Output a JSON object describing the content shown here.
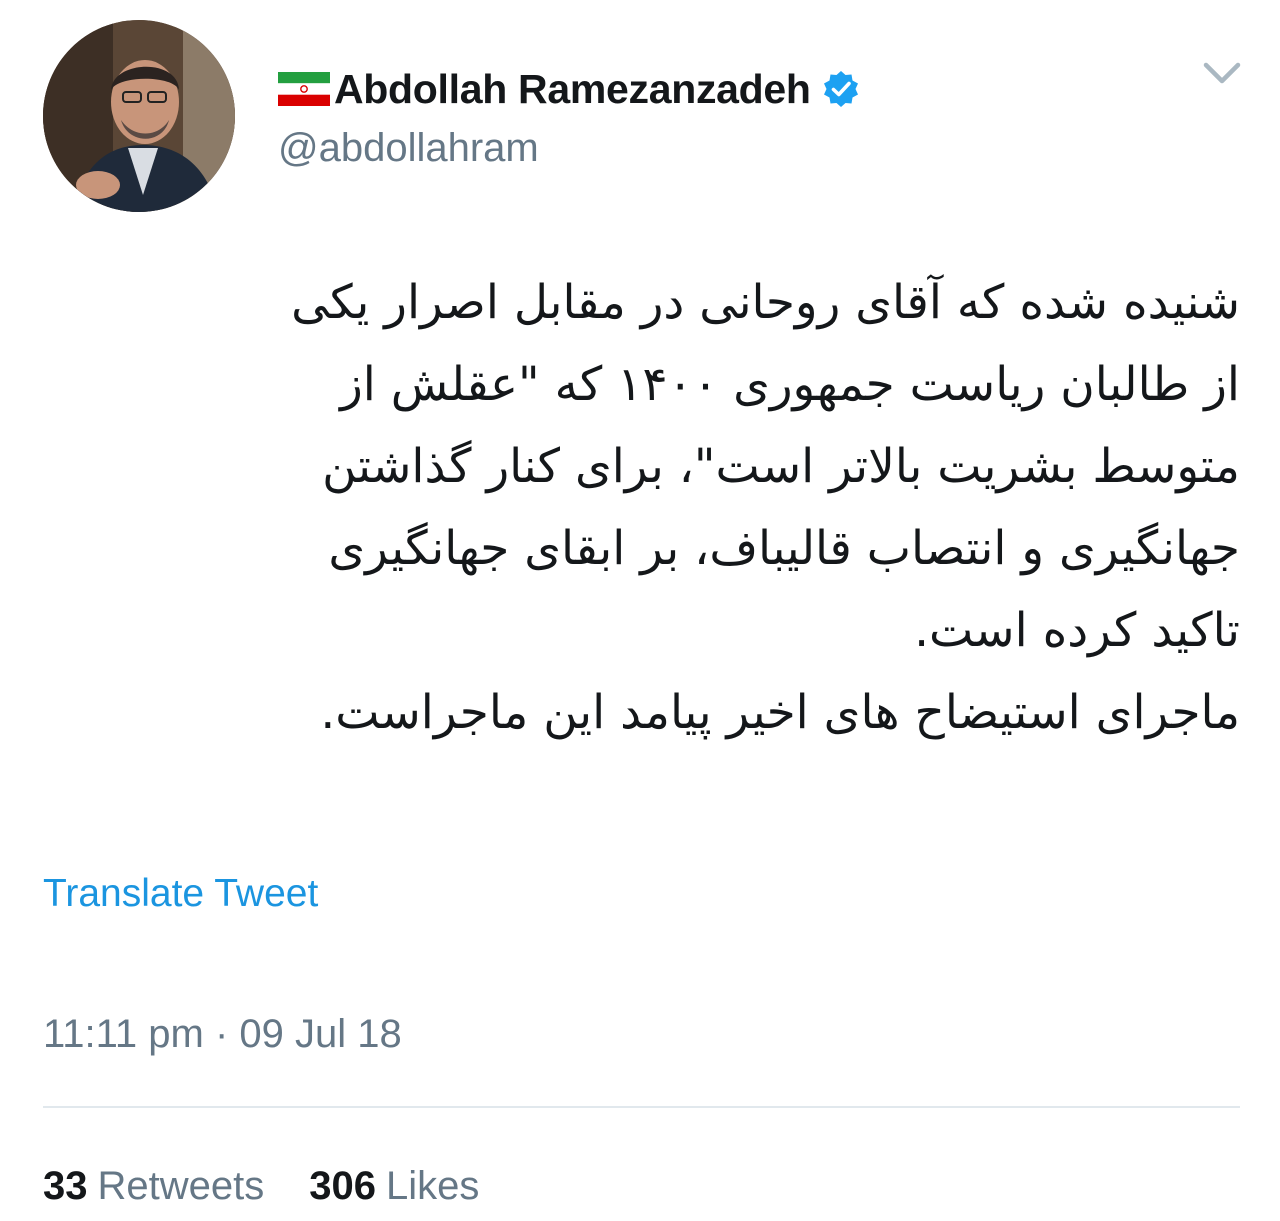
{
  "author": {
    "display_name": "Abdollah Ramezanzadeh",
    "handle": "@abdollahram",
    "verified": true,
    "flag": "iran-flag-icon",
    "avatar": "profile-photo"
  },
  "tweet": {
    "lines": [
      "شنیده شده که آقای روحانی در مقابل اصرار یکی",
      "از طالبان ریاست جمهوری ۱۴۰۰ که \"عقلش از",
      "متوسط بشریت بالاتر است\"، برای کنار گذاشتن",
      "جهانگیری و انتصاب قالیباف، بر ابقای جهانگیری",
      "تاکید کرده است.",
      "ماجرای استیضاح های اخیر پیامد این ماجراست."
    ]
  },
  "translate_label": "Translate Tweet",
  "timestamp": "11:11 pm · 09 Jul 18",
  "stats": {
    "retweets_count": "33",
    "retweets_label": "Retweets",
    "likes_count": "306",
    "likes_label": "Likes"
  },
  "colors": {
    "link": "#1b95e0",
    "secondary_text": "#657786",
    "primary_text": "#14171a",
    "divider": "#e1e8ed",
    "verified_badge": "#1da1f2"
  }
}
